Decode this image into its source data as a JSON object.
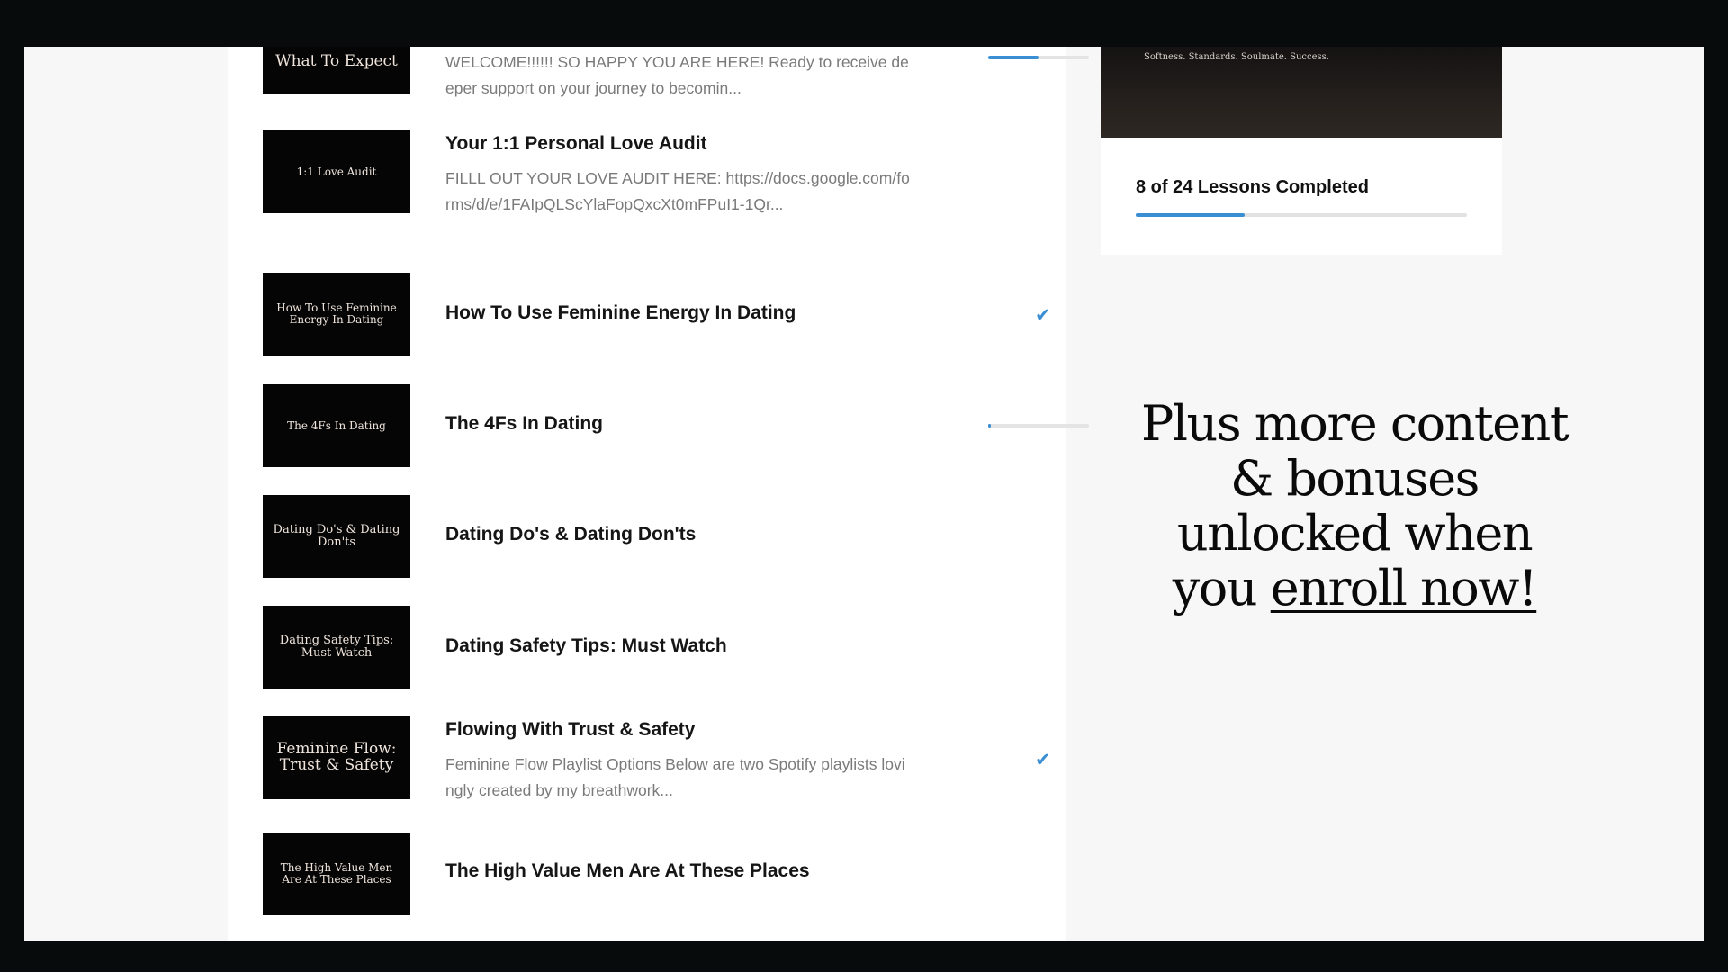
{
  "lessons": [
    {
      "thumb": "What To Expect",
      "title": "",
      "description": "WELCOME!!!!!! SO HAPPY YOU ARE HERE!   Ready to receive deeper support on your journey to becomin...",
      "status": "in-progress",
      "progress": 0.5
    },
    {
      "thumb": "1:1 Love Audit",
      "title": "Your 1:1 Personal Love Audit",
      "description": "FILLL OUT YOUR LOVE AUDIT HERE: https://docs.google.com/forms/d/e/1FAIpQLScYlaFopQxcXt0mFPuI1-1Qr..."
    },
    {
      "thumb": "How To Use Feminine Energy In Dating",
      "title": "How To Use Feminine Energy In Dating",
      "status": "completed"
    },
    {
      "thumb": "The 4Fs In Dating",
      "title": "The 4Fs In Dating",
      "status": "in-progress",
      "progress": 0.03
    },
    {
      "thumb": "Dating Do's & Dating Don'ts",
      "title": "Dating Do's & Dating Don'ts"
    },
    {
      "thumb": "Dating Safety Tips: Must Watch",
      "title": "Dating Safety Tips: Must Watch"
    },
    {
      "thumb": "Feminine Flow: Trust & Safety",
      "title": "Flowing With Trust & Safety",
      "description": " Feminine Flow Playlist Options Below are two Spotify playlists lovingly created by my breathwork...",
      "status": "completed"
    },
    {
      "thumb": "The High Value Men Are At These Places",
      "title": "The High Value Men Are At These Places"
    }
  ],
  "icons": {
    "completed": "checkmark-icon"
  },
  "colors": {
    "accent": "#3a8fd4",
    "background": "#f7f7f7",
    "frame": "#080b0c"
  },
  "course_card": {
    "tagline": "Softness. Standards. Soulmate. Success.",
    "completed_text": "8 of 24 Lessons Completed",
    "progress": 0.33
  },
  "promo": {
    "line1": "Plus more content",
    "line2": "& bonuses",
    "line3": "unlocked when",
    "line4_prefix": "you ",
    "line4_link": "enroll now!"
  }
}
